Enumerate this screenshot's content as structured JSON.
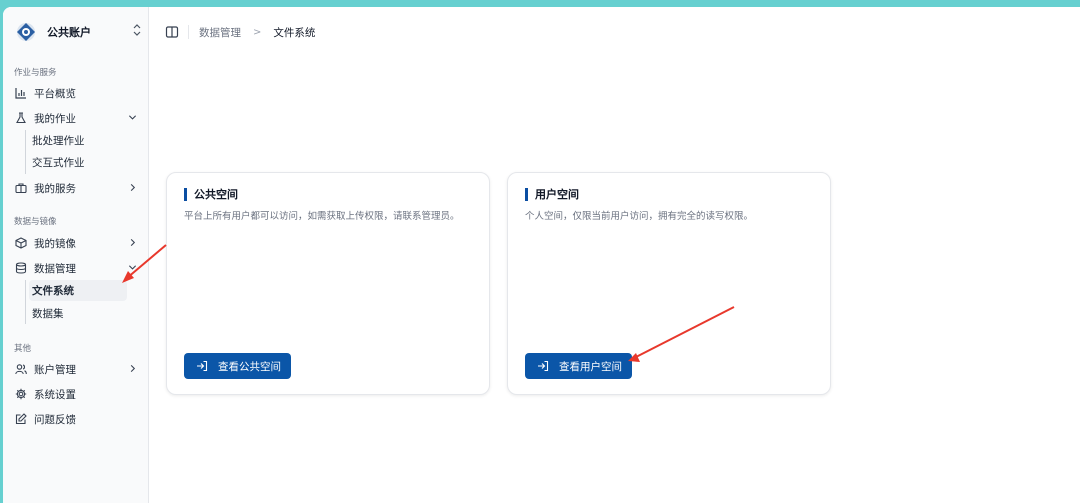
{
  "account": {
    "name": "公共账户"
  },
  "sidebar": {
    "groups": [
      {
        "label": "作业与服务"
      },
      {
        "label": "数据与镜像"
      },
      {
        "label": "其他"
      }
    ],
    "items": {
      "overview": "平台概览",
      "my_jobs": "我的作业",
      "batch_jobs": "批处理作业",
      "interactive_jobs": "交互式作业",
      "my_services": "我的服务",
      "my_images": "我的镜像",
      "data_management": "数据管理",
      "file_system": "文件系统",
      "datasets": "数据集",
      "account_management": "账户管理",
      "system_settings": "系统设置",
      "feedback": "问题反馈"
    }
  },
  "breadcrumb": {
    "parent": "数据管理",
    "separator": ">",
    "current": "文件系统"
  },
  "cards": {
    "public": {
      "title": "公共空间",
      "description": "平台上所有用户都可以访问，如需获取上传权限，请联系管理员。",
      "button": "查看公共空间"
    },
    "user": {
      "title": "用户空间",
      "description": "个人空间，仅限当前用户访问，拥有完全的读写权限。",
      "button": "查看用户空间"
    }
  },
  "colors": {
    "primary": "#0b56a8",
    "annotation_arrow": "#e8382c",
    "background_frame": "#66d0d0"
  }
}
